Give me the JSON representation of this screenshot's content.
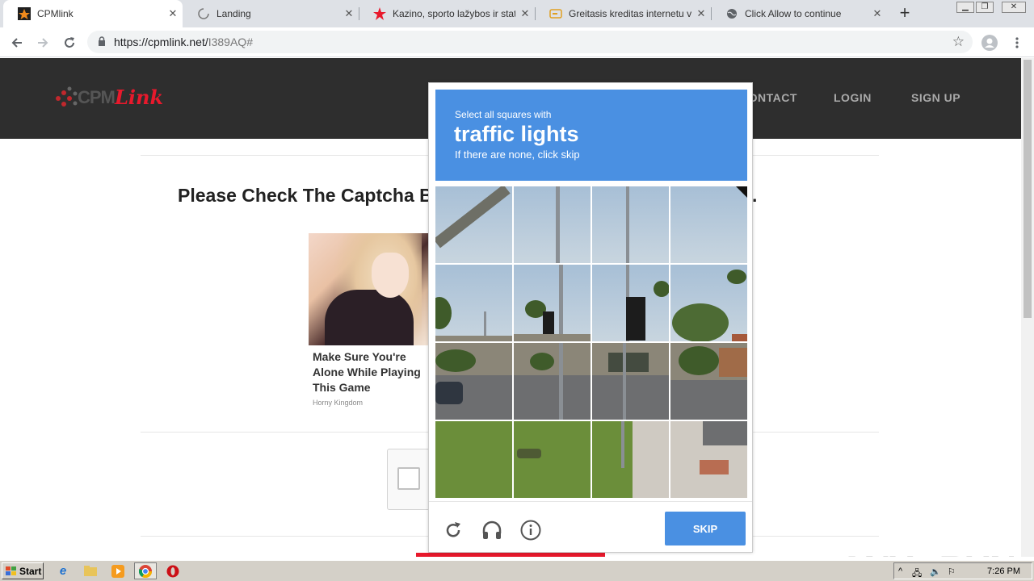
{
  "browser": {
    "tabs": [
      {
        "title": "CPMlink",
        "active": true,
        "icon": "star-favicon-icon"
      },
      {
        "title": "Landing",
        "active": false,
        "icon": "loading-spinner-icon"
      },
      {
        "title": "Kazino, sporto lažybos ir statym",
        "active": false,
        "icon": "red-star-icon"
      },
      {
        "title": "Greitasis kreditas internetu vos",
        "active": false,
        "icon": "credit-card-icon"
      },
      {
        "title": "Click Allow to continue",
        "active": false,
        "icon": "globe-icon"
      }
    ],
    "url_host": "https://cpmlink.net/",
    "url_path": "I389AQ#"
  },
  "site": {
    "logo_text_1": "CPM",
    "logo_text_2": "Link",
    "nav": [
      "CONTACT",
      "LOGIN",
      "SIGN UP"
    ],
    "headline": "Please Check The Captcha Below To Go To The Destination Page.",
    "ad_caption": "Make Sure You're Alone While Playing This Game",
    "ad_source": "Horny Kingdom"
  },
  "captcha": {
    "line1": "Select all squares with",
    "line2": "traffic lights",
    "line3": "If there are none, click skip",
    "skip_label": "SKIP"
  },
  "watermark": "ANY▷RUN",
  "taskbar": {
    "start_label": "Start",
    "time": "7:26 PM"
  },
  "colors": {
    "captcha_blue": "#4a90e2",
    "brand_red": "#e8192c",
    "header_dark": "#2e2e2e"
  }
}
